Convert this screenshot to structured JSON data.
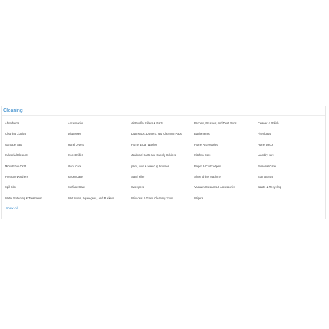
{
  "section": {
    "title": "Cleaning",
    "show_all_label": "Show All",
    "accent_color": "#2f86c9",
    "categories": [
      "Absorbents",
      "Accessories",
      "Air Purifier Filters & Parts",
      "Brooms, Brushes, and Dust Pans",
      "Cleaner & Polish",
      "Cleaning Liquids",
      "Dispenser",
      "Dust Mops, Dusters, and Cleaning Pads",
      "Equipments",
      "Filter bags",
      "Garbage Bag",
      "Hand Dryers",
      "Home & Car Washer",
      "Home Accessories",
      "Home Decor",
      "Industrial Cleaners",
      "Insect Killer",
      "Janitorial Carts and Supply Holders",
      "Kitchen Care",
      "Laundry care",
      "Micro Fiber Cloth",
      "Odor Care",
      "paint, wire & wire cup brushes",
      "Paper & Cloth Wipes",
      "Personal Care",
      "Pressure Washers",
      "Room Care",
      "Sand Filter",
      "Shoe Shine Machine",
      "Sign Boards",
      "Spill Kits",
      "Surface Care",
      "Sweepers",
      "Vacuum Cleaners & Accessories",
      "Waste & Recycling",
      "Water Softening & Treatment",
      "Wet Mops, Squeegees, and Buckets",
      "Windows & Glass Cleaning Tools",
      "Wipers"
    ]
  }
}
